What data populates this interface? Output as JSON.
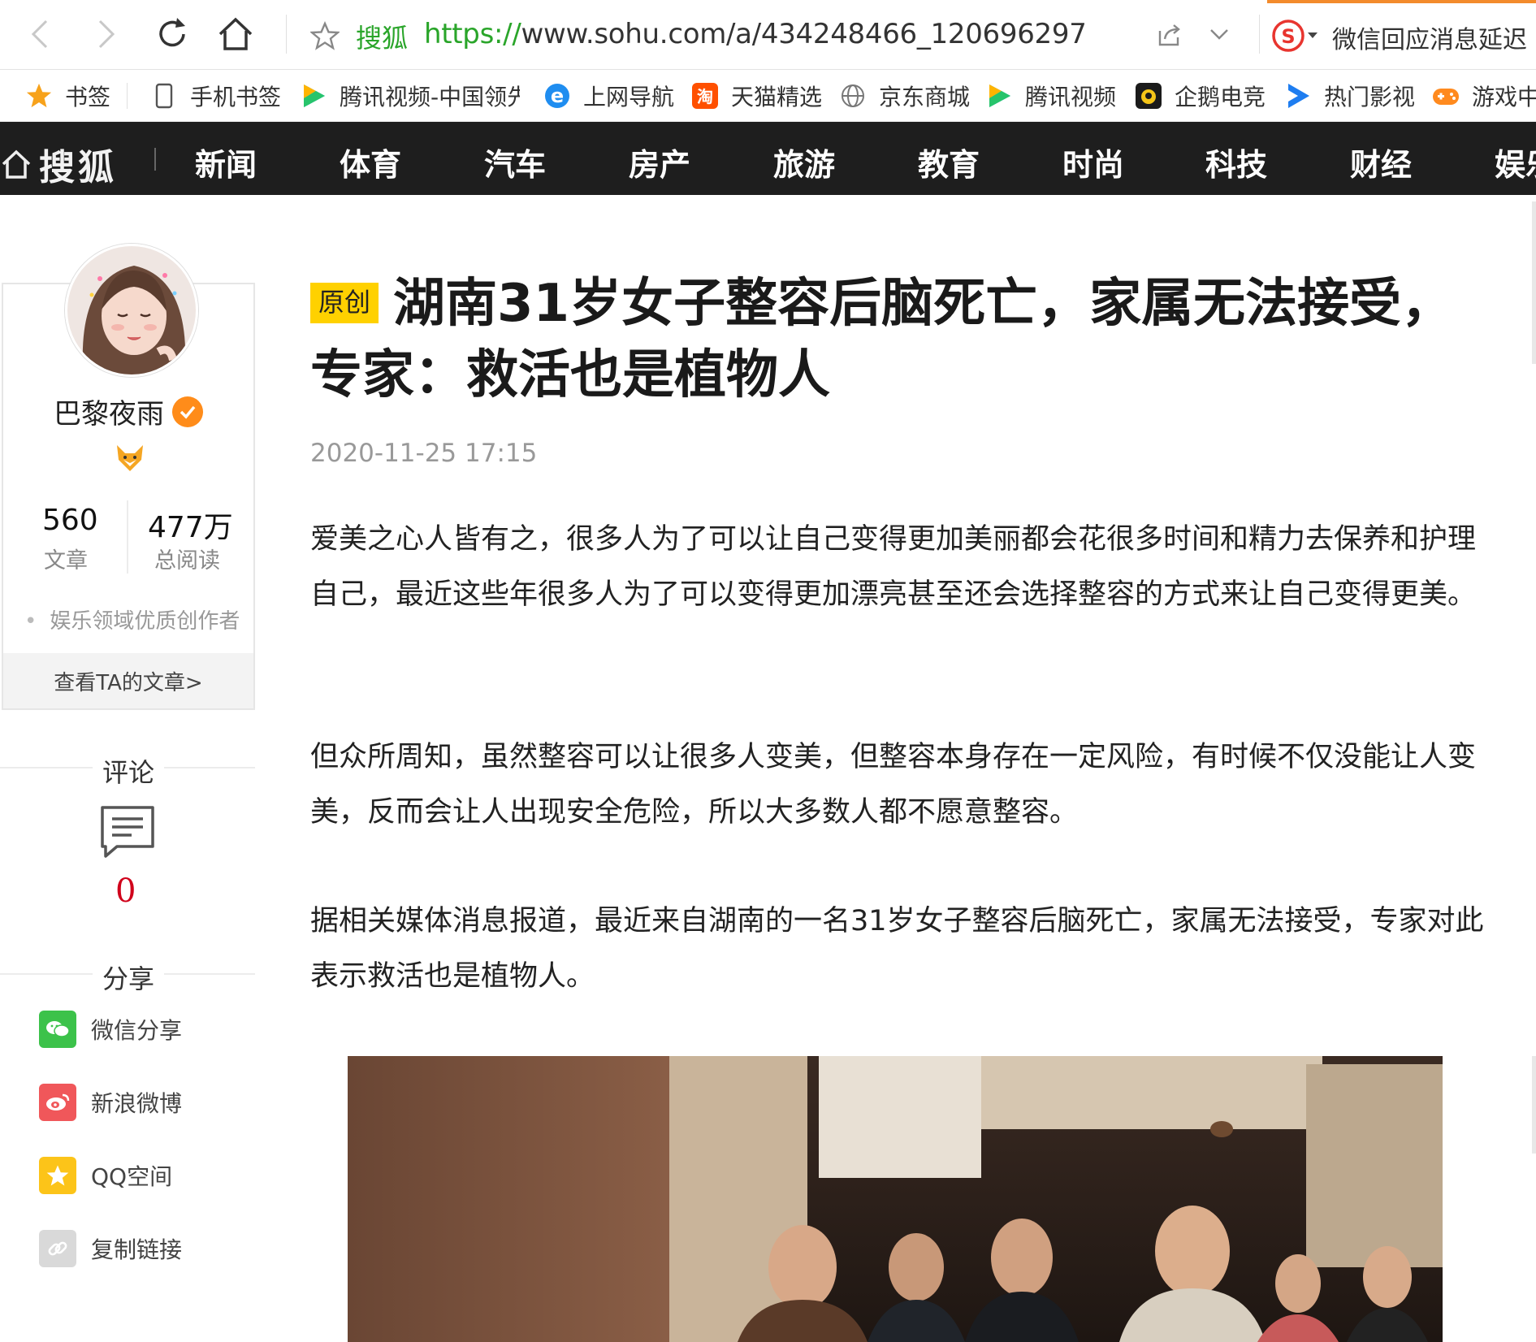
{
  "browser": {
    "site_name": "搜狐",
    "url_scheme": "https://",
    "url_rest": "www.sohu.com/a/434248466_120696297",
    "hot_news": "微信回应消息延迟"
  },
  "bookmarks": [
    {
      "label": "书签",
      "icon": "star-icon"
    },
    {
      "label": "手机书签",
      "icon": "phone-icon"
    },
    {
      "label": "腾讯视频-中国领先",
      "icon": "tencent-video-icon"
    },
    {
      "label": "上网导航",
      "icon": "ie-icon"
    },
    {
      "label": "天猫精选",
      "icon": "taobao-icon"
    },
    {
      "label": "京东商城",
      "icon": "globe-icon"
    },
    {
      "label": "腾讯视频",
      "icon": "tencent-video-icon"
    },
    {
      "label": "企鹅电竞",
      "icon": "penguin-esports-icon"
    },
    {
      "label": "热门影视",
      "icon": "play-icon"
    },
    {
      "label": "游戏中",
      "icon": "gamepad-icon"
    }
  ],
  "sohu_nav": {
    "logo": "搜狐",
    "items": [
      "新闻",
      "体育",
      "汽车",
      "房产",
      "旅游",
      "教育",
      "时尚",
      "科技",
      "财经",
      "娱乐"
    ]
  },
  "author": {
    "name": "巴黎夜雨",
    "articles_count": "560",
    "articles_label": "文章",
    "reads_count": "477万",
    "reads_label": "总阅读",
    "honor": "娱乐领域优质创作者",
    "view_more": "查看TA的文章>"
  },
  "comment": {
    "title": "评论",
    "count": "0"
  },
  "share": {
    "title": "分享",
    "items": [
      {
        "label": "微信分享",
        "color": "#3cc24a"
      },
      {
        "label": "新浪微博",
        "color": "#f0575a"
      },
      {
        "label": "QQ空间",
        "color": "#fcc419"
      },
      {
        "label": "复制链接",
        "color": "#d9d9d9"
      }
    ]
  },
  "article": {
    "badge": "原创",
    "title": "湖南31岁女子整容后脑死亡，家属无法接受，专家：救活也是植物人",
    "date": "2020-11-25 17:15",
    "paragraphs": [
      "爱美之心人皆有之，很多人为了可以让自己变得更加美丽都会花很多时间和精力去保养和护理自己，最近这些年很多人为了可以变得更加漂亮甚至还会选择整容的方式来让自己变得更美。",
      "但众所周知，虽然整容可以让很多人变美，但整容本身存在一定风险，有时候不仅没能让人变美，反而会让人出现安全危险，所以大多数人都不愿意整容。",
      "据相关媒体消息报道，最近来自湖南的一名31岁女子整容后脑死亡，家属无法接受，专家对此表示救活也是植物人。"
    ]
  },
  "colors": {
    "nav_bg": "#1e1e1e",
    "badge_bg": "#ffd100",
    "url_green": "#2aa52a",
    "comment_red": "#d0021b"
  }
}
